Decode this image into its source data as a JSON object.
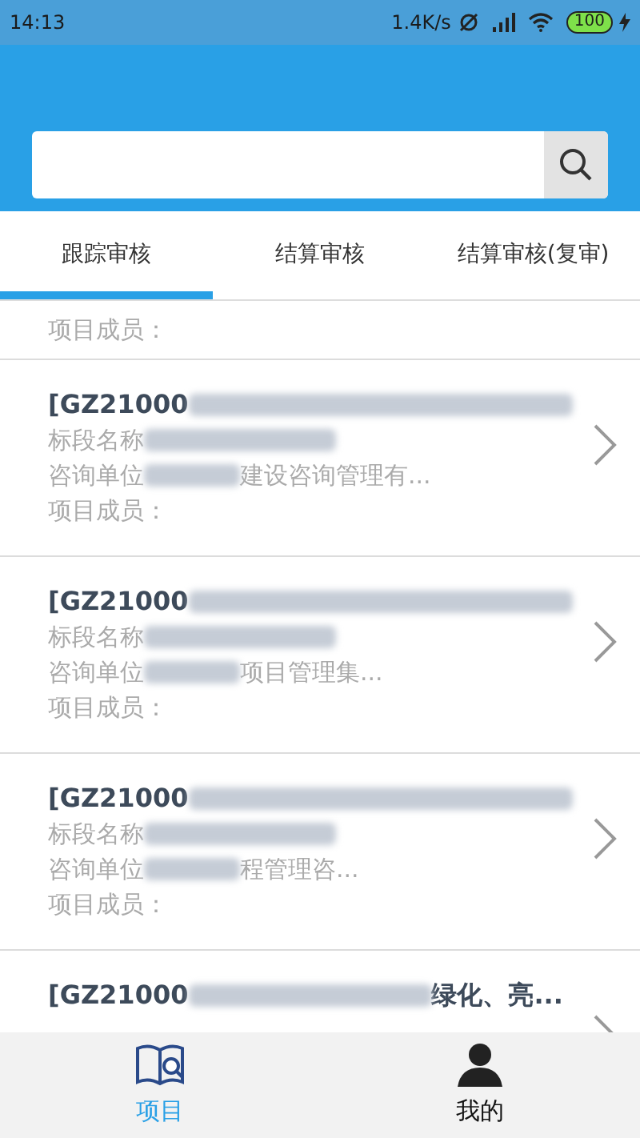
{
  "status_bar": {
    "time": "14:13",
    "speed": "1.4K/s",
    "battery": "100"
  },
  "tabs": [
    {
      "label": "跟踪审核",
      "selected": true
    },
    {
      "label": "结算审核",
      "selected": false
    },
    {
      "label": "结算审核(复审)",
      "selected": false
    }
  ],
  "partial_card": {
    "lines": [
      "项目成员："
    ]
  },
  "cards": [
    {
      "title": "[GZ21000",
      "lines": [
        {
          "label": "标段名称"
        },
        {
          "label": "咨询单位",
          "tail": "建设咨询管理有..."
        },
        {
          "label": "项目成员："
        }
      ]
    },
    {
      "title": "[GZ21000",
      "lines": [
        {
          "label": "标段名称"
        },
        {
          "label": "咨询单位",
          "tail": "项目管理集..."
        },
        {
          "label": "项目成员："
        }
      ]
    },
    {
      "title": "[GZ21000",
      "lines": [
        {
          "label": "标段名称"
        },
        {
          "label": "咨询单位",
          "tail": "程管理咨..."
        },
        {
          "label": "项目成员："
        }
      ]
    },
    {
      "title": "[GZ21000",
      "title_tail": "绿化、亮..."
    }
  ],
  "bottom_nav": [
    {
      "kind": "book",
      "label": "项目",
      "selected": true
    },
    {
      "kind": "person",
      "label": "我的",
      "selected": false
    }
  ]
}
